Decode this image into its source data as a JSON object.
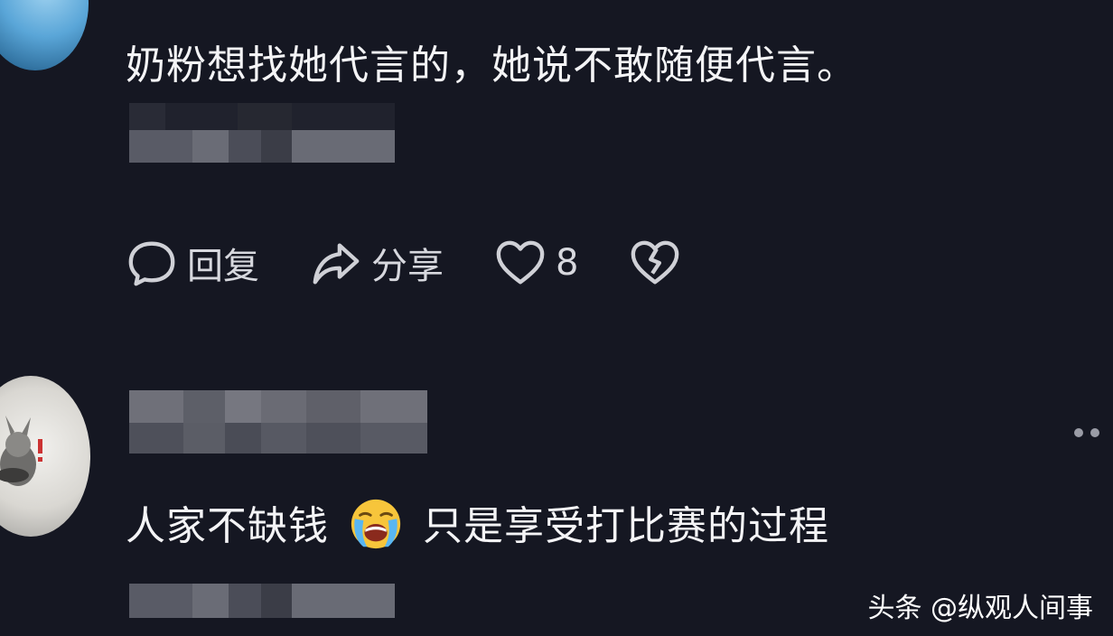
{
  "comments": [
    {
      "text": "奶粉想找她代言的，她说不敢随便代言。"
    },
    {
      "text_before": "人家不缺钱",
      "emoji": "loudly-crying-face",
      "text_after": "只是享受打比赛的过程"
    }
  ],
  "actions": {
    "reply_label": "回复",
    "share_label": "分享",
    "like_count": "8"
  },
  "icons": [
    "comment-bubble-icon",
    "share-arrow-icon",
    "heart-icon",
    "broken-heart-icon",
    "more-icon"
  ],
  "watermark": "头条 @纵观人间事",
  "colors": {
    "background": "#151722",
    "text": "#f4f4f6",
    "icon": "#cfd0d6"
  }
}
